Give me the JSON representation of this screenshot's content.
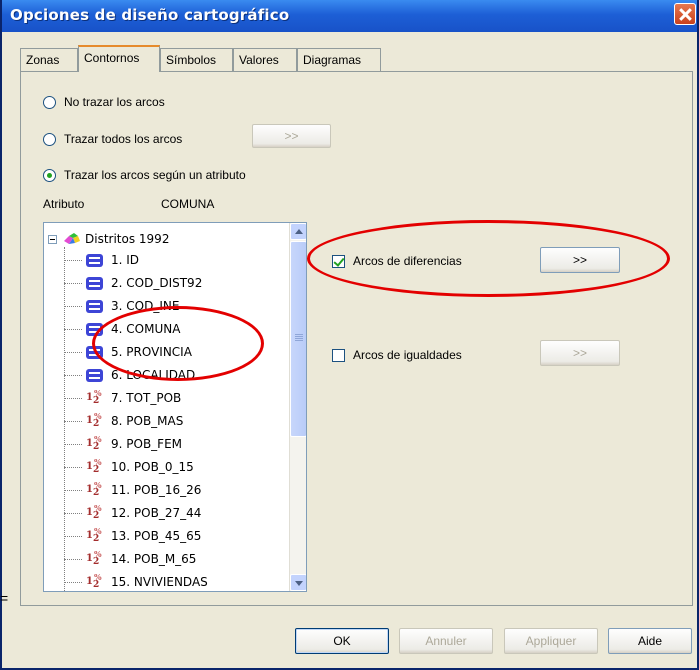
{
  "window": {
    "title": "Opciones de diseño cartográfico"
  },
  "tabs": [
    {
      "label": "Zonas",
      "active": false
    },
    {
      "label": "Contornos",
      "active": true
    },
    {
      "label": "Símbolos",
      "active": false
    },
    {
      "label": "Valores",
      "active": false
    },
    {
      "label": "Diagramas",
      "active": false
    }
  ],
  "options": {
    "no_trazar": "No trazar los arcos",
    "trazar_todos": "Trazar todos los arcos",
    "trazar_atributo": "Trazar los arcos según un atributo",
    "selected": "trazar_atributo"
  },
  "browse_label": ">>",
  "attribute": {
    "label": "Atributo",
    "value": "COMUNA"
  },
  "tree": {
    "root": "Distritos 1992",
    "items": [
      {
        "label": "1. ID",
        "icon": "text-field-icon"
      },
      {
        "label": "2. COD_DIST92",
        "icon": "text-field-icon"
      },
      {
        "label": "3. COD_INE",
        "icon": "text-field-icon"
      },
      {
        "label": "4. COMUNA",
        "icon": "text-field-icon"
      },
      {
        "label": "5. PROVINCIA",
        "icon": "text-field-icon"
      },
      {
        "label": "6. LOCALIDAD",
        "icon": "text-field-icon"
      },
      {
        "label": "7. TOT_POB",
        "icon": "numeric-field-icon"
      },
      {
        "label": "8. POB_MAS",
        "icon": "numeric-field-icon"
      },
      {
        "label": "9. POB_FEM",
        "icon": "numeric-field-icon"
      },
      {
        "label": "10. POB_0_15",
        "icon": "numeric-field-icon"
      },
      {
        "label": "11. POB_16_26",
        "icon": "numeric-field-icon"
      },
      {
        "label": "12. POB_27_44",
        "icon": "numeric-field-icon"
      },
      {
        "label": "13. POB_45_65",
        "icon": "numeric-field-icon"
      },
      {
        "label": "14. POB_M_65",
        "icon": "numeric-field-icon"
      },
      {
        "label": "15. NVIVIENDAS",
        "icon": "numeric-field-icon"
      }
    ]
  },
  "checks": {
    "diferencias": {
      "label": "Arcos de diferencias",
      "checked": true
    },
    "igualdades": {
      "label": "Arcos de igualdades",
      "checked": false
    }
  },
  "footer": {
    "ok": "OK",
    "annuler": "Annuler",
    "appliquer": "Appliquer",
    "aide": "Aide"
  },
  "side_mark": "=",
  "colors": {
    "highlight": "#e30000",
    "titlebar": "#1d5fd6",
    "dialog_bg": "#ece9d8"
  }
}
